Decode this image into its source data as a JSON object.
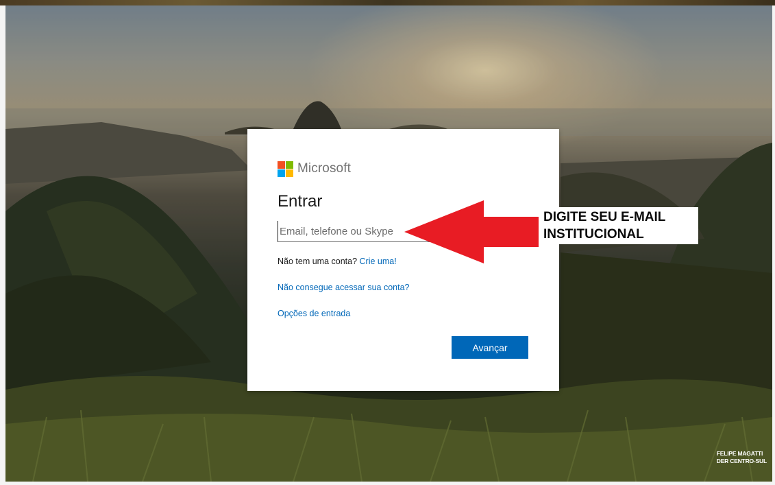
{
  "brand": {
    "name": "Microsoft",
    "logo_colors": [
      "#f25022",
      "#7fba00",
      "#00a4ef",
      "#ffb900"
    ]
  },
  "signin": {
    "title": "Entrar",
    "email_placeholder": "Email, telefone ou Skype",
    "email_value": "",
    "no_account_text": "Não tem uma conta?",
    "create_account_link": "Crie uma!",
    "cant_access_link": "Não consegue acessar sua conta?",
    "signin_options_link": "Opções de entrada",
    "next_button": "Avançar"
  },
  "annotation": {
    "line1": "DIGITE SEU E-MAIL",
    "line2": "INSTITUCIONAL",
    "arrow_color": "#e81c24"
  },
  "credit": {
    "line1": "FELIPE MAGATTI",
    "line2": "DER CENTRO-SUL"
  },
  "colors": {
    "accent": "#0067b8",
    "card": "#ffffff"
  }
}
